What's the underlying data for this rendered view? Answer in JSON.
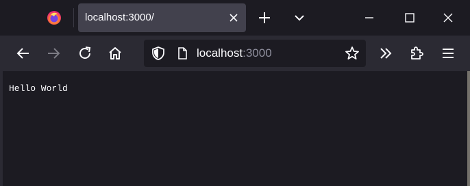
{
  "browser": {
    "tab": {
      "title": "localhost:3000/"
    },
    "url": {
      "host": "localhost",
      "port": ":3000"
    },
    "icons": {
      "logo": "firefox-logo-icon",
      "tab_close": "close-icon",
      "new_tab": "plus-icon",
      "list_tabs": "chevron-down-icon",
      "minimize": "minimize-icon",
      "maximize": "maximize-icon",
      "close_window": "close-icon",
      "back": "arrow-left-icon",
      "forward": "arrow-right-icon",
      "reload": "reload-icon",
      "home": "home-icon",
      "tracking": "shield-icon",
      "page": "page-icon",
      "bookmark": "star-icon",
      "overflow": "double-chevron-right-icon",
      "extensions": "puzzle-icon",
      "menu": "hamburger-menu-icon"
    }
  },
  "page": {
    "body_text": "Hello World"
  },
  "colors": {
    "tabbar_bg": "#1c1b22",
    "toolbar_bg": "#2b2a33",
    "active_tab_bg": "#42414d",
    "text": "#fbfbfe",
    "muted_text": "#8f8f9d"
  }
}
